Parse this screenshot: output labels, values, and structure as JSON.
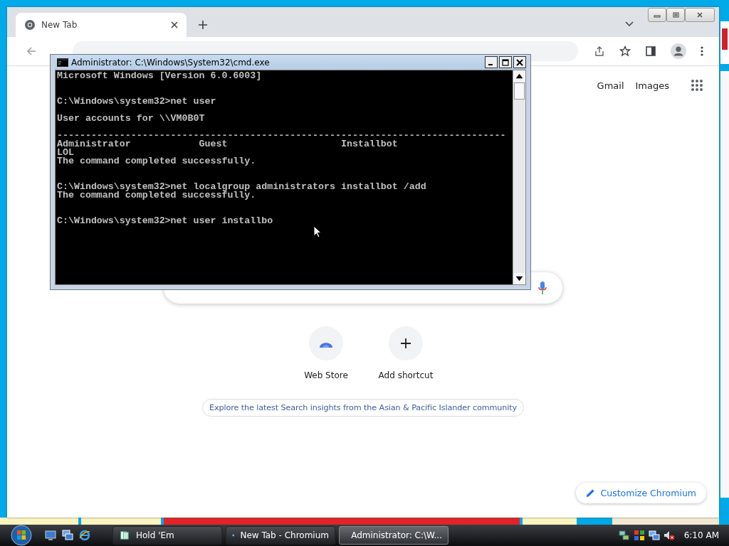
{
  "browser": {
    "tabs": [
      {
        "label": "New Tab",
        "selected": true
      }
    ],
    "links": [
      "Gmail",
      "Images"
    ],
    "shortcuts": [
      {
        "label": "Web Store",
        "kind": "store"
      },
      {
        "label": "Add shortcut",
        "kind": "add"
      }
    ],
    "promo": "Explore the latest Search insights from the Asian & Pacific Islander community",
    "customize": "Customize Chromium"
  },
  "console": {
    "title": "Administrator: C:\\Windows\\System32\\cmd.exe",
    "sections": [
      {
        "paragraphs": [
          [
            "Microsoft Windows [Version 6.0.6003]"
          ]
        ]
      },
      {
        "paragraphs": [
          [
            "C:\\Windows\\system32>net user"
          ],
          [
            "User accounts for \\\\VM0B0T"
          ],
          [
            "-------------------------------------------------------------------------------",
            "Administrator            Guest                    Installbot",
            "LOL",
            "The command completed successfully."
          ]
        ]
      },
      {
        "paragraphs": [
          [
            "C:\\Windows\\system32>net localgroup administrators installbot /add",
            "The command completed successfully."
          ]
        ]
      },
      {
        "paragraphs": [
          [
            "C:\\Windows\\system32>net user installbo"
          ]
        ]
      }
    ]
  },
  "taskbar": {
    "tasks": [
      {
        "label": "Hold 'Em",
        "kind": "cards",
        "selected": false
      },
      {
        "label": "New Tab - Chromium",
        "kind": "browser",
        "selected": false
      },
      {
        "label": "Administrator: C:\\W...",
        "kind": "console",
        "selected": true
      }
    ],
    "clock": "6:10 AM"
  }
}
